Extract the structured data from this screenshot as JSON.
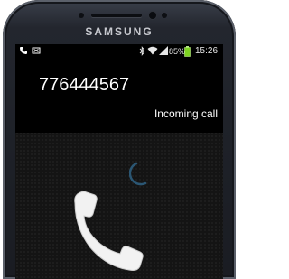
{
  "device": {
    "brand": "SAMSUNG"
  },
  "status_bar": {
    "battery_level": "85%",
    "time": "15:26",
    "left_icons": [
      "call-icon",
      "missed-call-notification-icon"
    ],
    "right_icons": [
      "bluetooth-icon",
      "wifi-icon",
      "signal-icon",
      "battery-icon"
    ]
  },
  "call": {
    "caller_number": "776444567",
    "status_label": "Incoming call"
  },
  "colors": {
    "screen_bg": "#141414",
    "header_bg": "#000000",
    "handset": "#ffffff",
    "accent_ring": "#2b5673"
  }
}
